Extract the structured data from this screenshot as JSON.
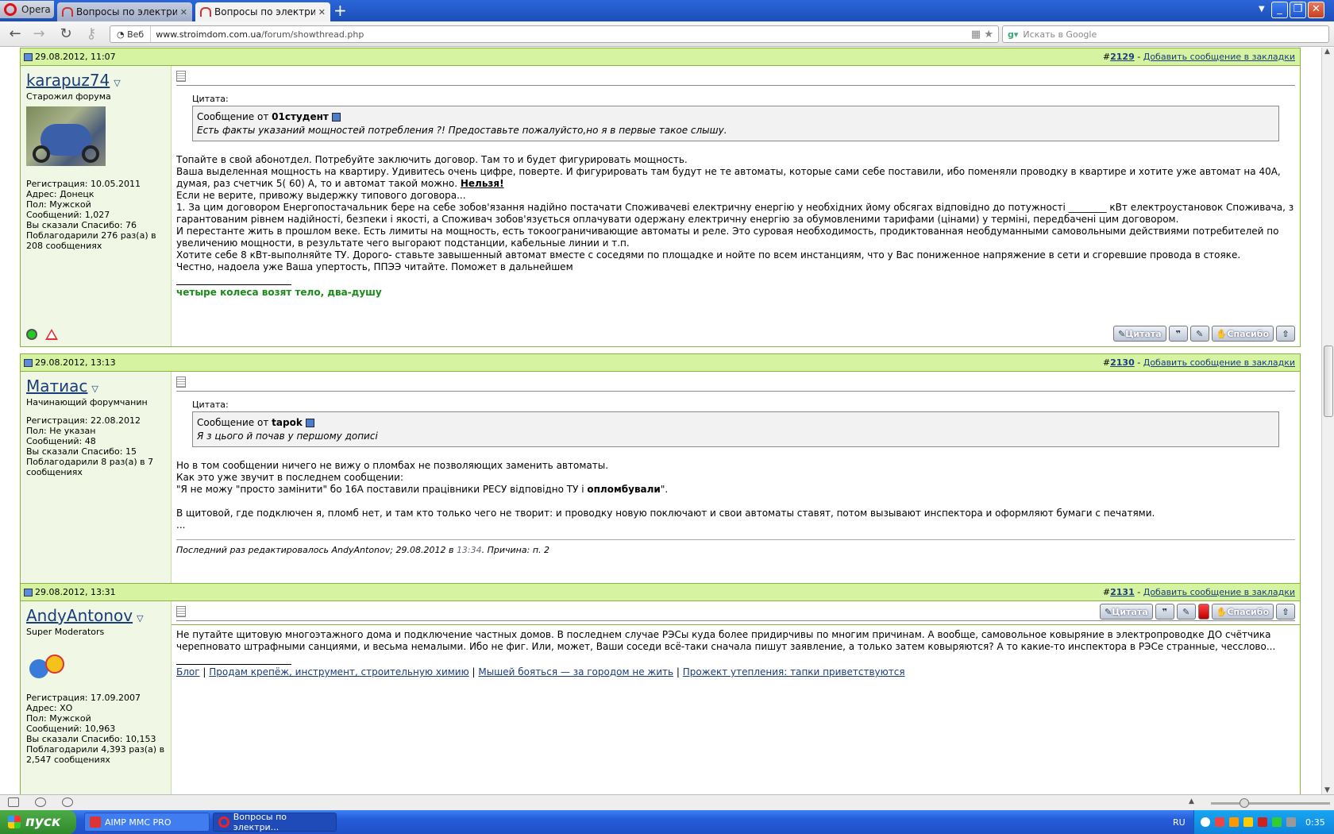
{
  "browser": {
    "menu_label": "Opera",
    "tabs": [
      {
        "title": "Вопросы по электрике,..."
      },
      {
        "title": "Вопросы по электрике,..."
      }
    ],
    "new_tab": "+",
    "url_prefix": "Веб",
    "url_domain": "www.stroimdom.com.ua",
    "url_path": "/forum/showthread.php",
    "search_placeholder": "Искать в Google"
  },
  "posts": [
    {
      "date": "29.08.2012, 11:07",
      "number": "2129",
      "bookmark": "Добавить сообщение в закладки",
      "user": {
        "name": "karapuz74",
        "title": "Старожил форума",
        "info": [
          "Регистрация: 10.05.2011",
          "Адрес: Донецк",
          "Пол: Мужской",
          "Сообщений: 1,027",
          "Вы сказали Спасибо: 76",
          "Поблагодарили 276 раз(а) в 208 сообщениях"
        ]
      },
      "quote_label": "Цитата:",
      "quote_from_prefix": "Сообщение от",
      "quote_author": "01студент",
      "quote_text": "Есть факты указаний мощностей потребления ?! Предоставьте пожалуйсто,но я в первые такое слышу.",
      "lines": [
        "Топайте в свой абонотдел. Потребуйте заключить договор. Там то и будет фигурировать мощность.",
        "Ваша выделенная мощность на квартиру. Удивитесь очень цифре, поверте. И фигурировать там будут не те автоматы, которые сами себе поставили, ибо поменяли проводку в квартире и хотите уже автомат на 40А, думая, раз счетчик 5( 60) А, то и автомат такой можно.",
        "Нельзя!",
        "Если не верите, привожу выдержку типового договора...",
        "1. За цим договором Енергопостачальник бере на себе зобов'язання надійно постачати Споживачеві електричну енергію у необхідних йому обсягах відповідно до потужності ________ кВт електроустановок Споживача, з гарантованим рівнем надійності, безпеки і якості, а Споживач зобов'язується оплачувати одержану електричну енергію за обумовленими тарифами (цінами) у терміні, передбачені цим договором.",
        "И перестанте жить в прошлом веке. Есть лимиты на мощность, есть токоограничивающие автоматы и реле. Это суровая необходимость, продиктованная необдуманными самовольными действиями потребителей по увеличению мощности, в результате чего выгорают подстанции, кабельные линии и т.п.",
        "Хотите себе 8 кВт-выполняйте ТУ. Дорого- ставьте завышенный автомат вместе с соседями по площадке и нойте по всем инстанциям, что у Вас пониженное напряжение в сети и сгоревшие провода в стояке.",
        "Честно, надоела уже Ваша упертость, ППЭЭ читайте. Поможет в дальнейшем"
      ],
      "signature": "четыре колеса возят тело, два-душу",
      "btn_quote": "Цитата",
      "btn_thanks": "Спасибо"
    },
    {
      "date": "29.08.2012, 13:13",
      "number": "2130",
      "bookmark": "Добавить сообщение в закладки",
      "user": {
        "name": "Матиас",
        "title": "Начинающий форумчанин",
        "info": [
          "Регистрация: 22.08.2012",
          "Пол: Не указан",
          "Сообщений: 48",
          "Вы сказали Спасибо: 15",
          "Поблагодарили 8 раз(а) в 7 сообщениях"
        ]
      },
      "quote_label": "Цитата:",
      "quote_from_prefix": "Сообщение от",
      "quote_author": "tapok",
      "quote_text": "Я з цього й почав у першому дописі",
      "lines": [
        "Но в том сообщении ничего не вижу о пломбах не позволяющих заменить автоматы.",
        "Как это уже звучит в последнем сообщении:",
        "\"Я не можу \"просто замінити\" бо 16А поставили працівники РЕСУ відповідно ТУ і",
        "опломбували",
        "\".",
        "В щитовой, где подключен я, пломб нет, и там кто только чего не творит: и проводку новую поключают и свои автоматы ставят, потом вызывают инспектора и оформляют бумаги с печатями.",
        "..."
      ],
      "edited_prefix": "Последний раз редактировалось AndyAntonov; 29.08.2012 в",
      "edited_time": "13:34",
      "edited_reason": ". Причина: п. 2",
      "btn_quote": "Цитата",
      "btn_thanks": "Спасибо"
    },
    {
      "date": "29.08.2012, 13:31",
      "number": "2131",
      "bookmark": "Добавить сообщение в закладки",
      "user": {
        "name": "AndyAntonov",
        "title": "Super Moderators",
        "info": [
          "Регистрация: 17.09.2007",
          "Адрес: ХО",
          "Пол: Мужской",
          "Сообщений: 10,963",
          "Вы сказали Спасибо: 10,153",
          "Поблагодарили 4,393 раз(а) в 2,547 сообщениях"
        ]
      },
      "lines": [
        "Не путайте щитовую многоэтажного дома и подключение частных домов. В последнем случае РЭСы куда более придирчивы по многим причинам. А вообще, самовольное ковыряние в электропроводке ДО счётчика черепновато штрафными санциями, и весьма немалыми. Ибо не фиг. Или, может, Ваши соседи всё-таки сначала пишут заявление, а только затем ковыряются? А то какие-то инспектора в РЭСе странные, чесслово..."
      ],
      "sig_links": [
        "Блог",
        "Продам крепёж, инструмент, строительную химию",
        "Мышей бояться — за городом не жить",
        "Прожект утепления: тапки приветствуются"
      ],
      "sig_sep": "|"
    }
  ],
  "taskbar": {
    "start": "пуск",
    "items": [
      "AIMP MMC PRO",
      "Вопросы по электри..."
    ],
    "lang": "RU",
    "clock": "0:35"
  }
}
